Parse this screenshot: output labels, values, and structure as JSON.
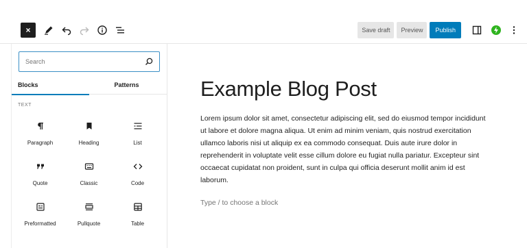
{
  "toolbar": {
    "close_glyph": "×",
    "tools": [
      {
        "name": "edit-icon"
      },
      {
        "name": "undo-icon"
      },
      {
        "name": "redo-icon"
      },
      {
        "name": "details-icon"
      },
      {
        "name": "list-view-icon"
      }
    ],
    "save_draft_label": "Save draft",
    "preview_label": "Preview",
    "publish_label": "Publish",
    "publish_color": "#007cba",
    "right_icons": [
      "settings-sidebar-icon",
      "jetpack-icon",
      "more-options-icon"
    ],
    "jetpack_color": "#2fb41f"
  },
  "inserter": {
    "search": {
      "placeholder": "Search",
      "value": ""
    },
    "tabs": [
      {
        "label": "Blocks",
        "active": true
      },
      {
        "label": "Patterns",
        "active": false
      }
    ],
    "category_label": "TEXT",
    "blocks": [
      {
        "label": "Paragraph",
        "icon": "paragraph-icon"
      },
      {
        "label": "Heading",
        "icon": "heading-icon"
      },
      {
        "label": "List",
        "icon": "list-icon"
      },
      {
        "label": "Quote",
        "icon": "quote-icon"
      },
      {
        "label": "Classic",
        "icon": "classic-icon"
      },
      {
        "label": "Code",
        "icon": "code-icon"
      },
      {
        "label": "Preformatted",
        "icon": "preformatted-icon"
      },
      {
        "label": "Pullquote",
        "icon": "pullquote-icon"
      },
      {
        "label": "Table",
        "icon": "table-icon"
      }
    ]
  },
  "editor": {
    "title": "Example Blog Post",
    "body": "Lorem ipsum dolor sit amet, consectetur adipiscing elit, sed do eiusmod tempor incididunt ut labore et dolore magna aliqua. Ut enim ad minim veniam, quis nostrud exercitation ullamco laboris nisi ut aliquip ex ea commodo consequat. Duis aute irure dolor in reprehenderit in voluptate velit esse cillum dolore eu fugiat nulla pariatur. Excepteur sint occaecat cupidatat non proident, sunt in culpa qui officia deserunt mollit anim id est laborum.",
    "appender_placeholder": "Type / to choose a block"
  }
}
